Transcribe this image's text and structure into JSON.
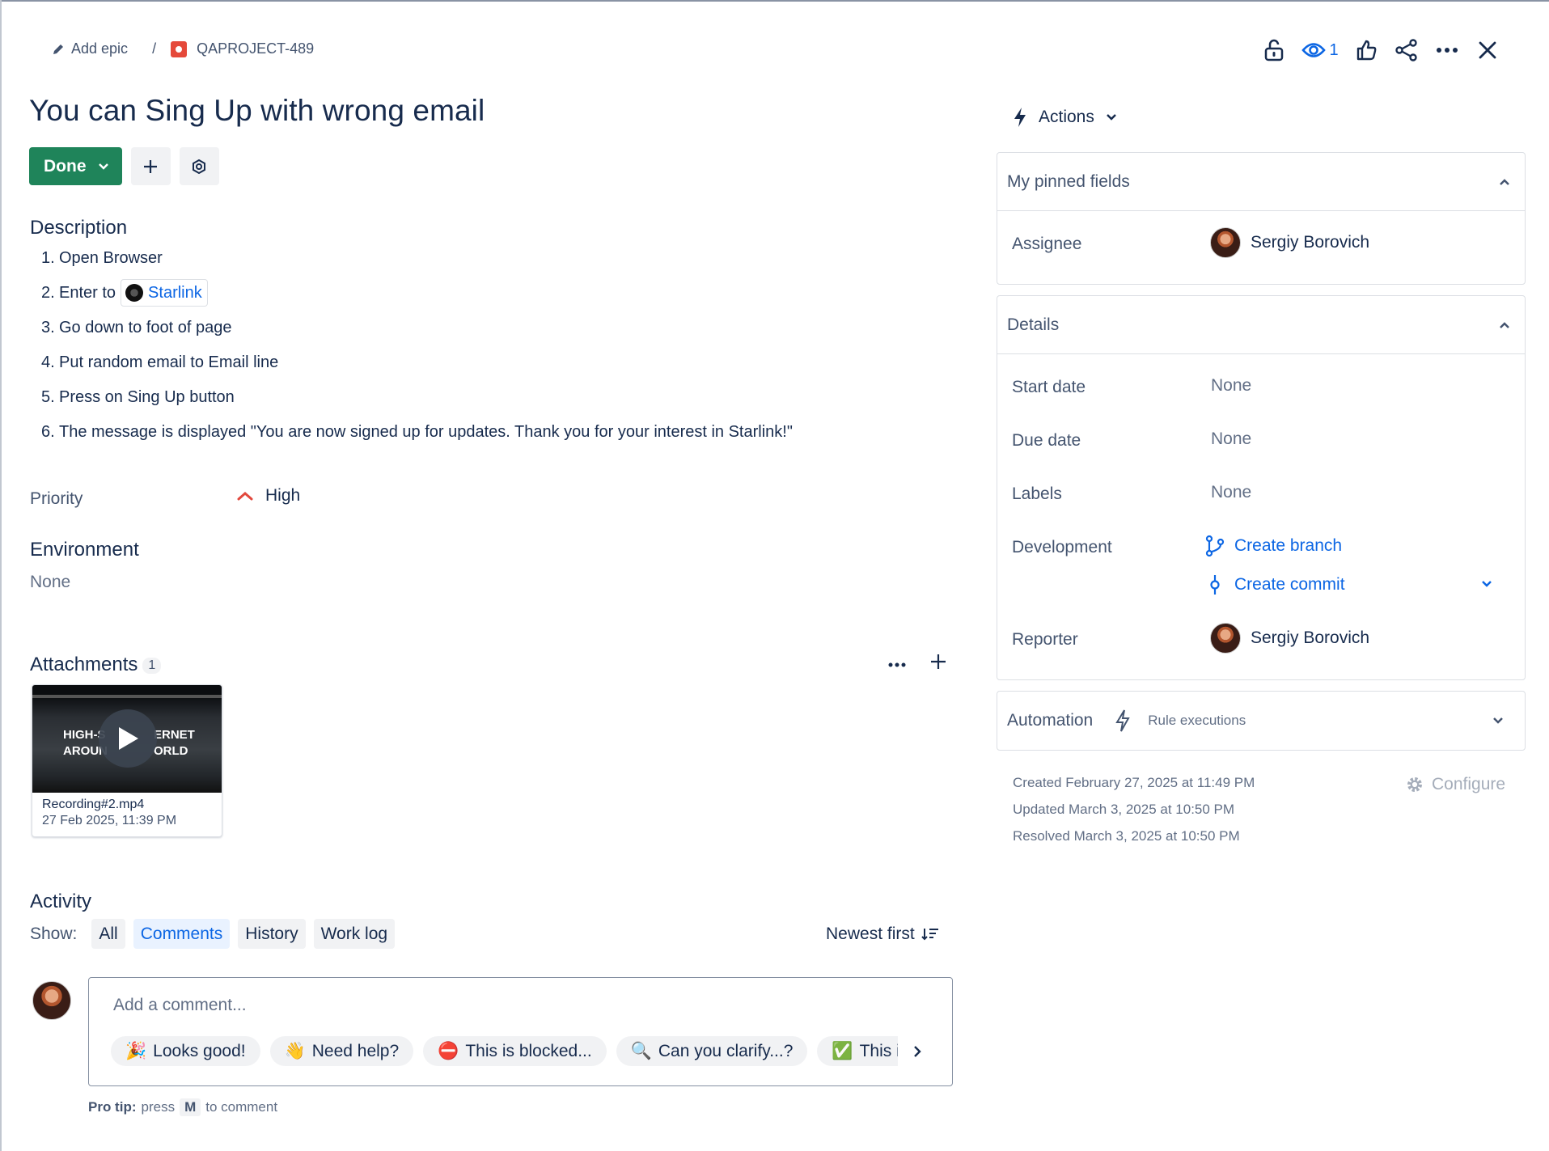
{
  "breadcrumb": {
    "add_epic": "Add epic",
    "separator": "/",
    "issue_key": "QAPROJECT-489"
  },
  "header": {
    "watch_count": "1"
  },
  "issue": {
    "title": "You can Sing Up with wrong email",
    "status": "Done"
  },
  "description": {
    "heading": "Description",
    "steps": [
      {
        "num": "1.",
        "text": "Open Browser"
      },
      {
        "num": "2.",
        "text": "Enter to",
        "link": "Starlink"
      },
      {
        "num": "3.",
        "text": "Go down to foot of page"
      },
      {
        "num": "4.",
        "text": "Put random email to Email line"
      },
      {
        "num": "5.",
        "text": "Press on Sing Up button"
      },
      {
        "num": "6.",
        "text": "The message is displayed \"You are now signed up for updates. Thank you for your interest in Starlink!\""
      }
    ]
  },
  "priority": {
    "label": "Priority",
    "value": "High"
  },
  "environment": {
    "heading": "Environment",
    "value": "None"
  },
  "attachments": {
    "heading": "Attachments",
    "count": "1",
    "items": [
      {
        "name": "Recording#2.mp4",
        "date": "27 Feb 2025, 11:39 PM",
        "thumb_line1": "HIGH-S",
        "thumb_line1b": "ERNET",
        "thumb_line2": "AROUN",
        "thumb_line2b": "ORLD"
      }
    ]
  },
  "activity": {
    "heading": "Activity",
    "show_label": "Show:",
    "tabs": [
      "All",
      "Comments",
      "History",
      "Work log"
    ],
    "active_tab": "Comments",
    "sort": "Newest first",
    "comment_placeholder": "Add a comment...",
    "chips": [
      {
        "emoji": "🎉",
        "label": "Looks good!"
      },
      {
        "emoji": "👋",
        "label": "Need help?"
      },
      {
        "emoji": "⛔",
        "label": "This is blocked..."
      },
      {
        "emoji": "🔍",
        "label": "Can you clarify...?"
      },
      {
        "emoji": "✅",
        "label": "This i"
      }
    ],
    "pro_tip_bold": "Pro tip:",
    "pro_tip_press": "press",
    "pro_tip_key": "M",
    "pro_tip_rest": "to comment"
  },
  "sidebar": {
    "actions_label": "Actions",
    "pinned": {
      "heading": "My pinned fields",
      "assignee_label": "Assignee",
      "assignee": "Sergiy Borovich"
    },
    "details": {
      "heading": "Details",
      "start_date_label": "Start date",
      "start_date": "None",
      "due_date_label": "Due date",
      "due_date": "None",
      "labels_label": "Labels",
      "labels": "None",
      "development_label": "Development",
      "create_branch": "Create branch",
      "create_commit": "Create commit",
      "reporter_label": "Reporter",
      "reporter": "Sergiy Borovich"
    },
    "automation": {
      "heading": "Automation",
      "rule_executions": "Rule executions"
    },
    "meta": {
      "created": "Created February 27, 2025 at 11:49 PM",
      "updated": "Updated March 3, 2025 at 10:50 PM",
      "resolved": "Resolved March 3, 2025 at 10:50 PM",
      "configure": "Configure"
    }
  },
  "colors": {
    "done_green": "#1f845a",
    "link_blue": "#0c66e4",
    "priority_orange": "#e2483d"
  }
}
